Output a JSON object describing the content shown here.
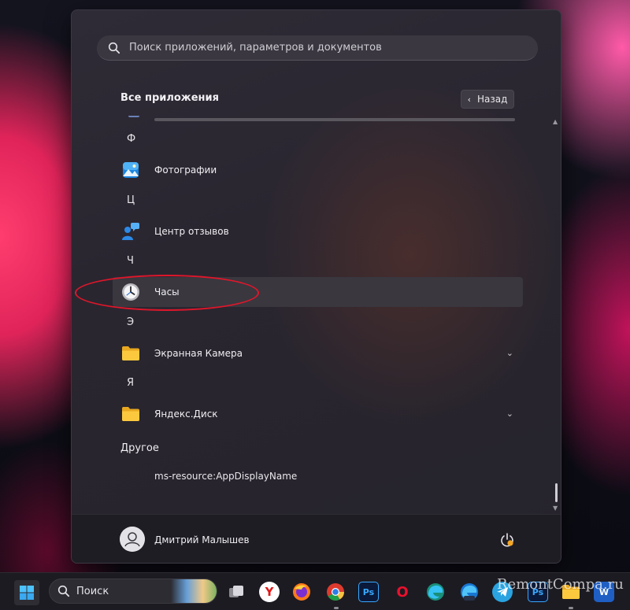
{
  "search": {
    "placeholder": "Поиск приложений, параметров и документов",
    "icon": "search-icon"
  },
  "all_apps": {
    "title": "Все приложения",
    "back_label": "Назад",
    "groups": [
      {
        "letter": "Ф",
        "apps": [
          {
            "label": "Фотографии",
            "icon": "photos-icon"
          }
        ]
      },
      {
        "letter": "Ц",
        "apps": [
          {
            "label": "Центр отзывов",
            "icon": "feedback-hub-icon"
          }
        ]
      },
      {
        "letter": "Ч",
        "apps": [
          {
            "label": "Часы",
            "icon": "clock-icon",
            "highlighted": true
          }
        ]
      },
      {
        "letter": "Э",
        "apps": [
          {
            "label": "Экранная Камера",
            "icon": "folder-icon",
            "expandable": true
          }
        ]
      },
      {
        "letter": "Я",
        "apps": [
          {
            "label": "Яндекс.Диск",
            "icon": "folder-icon",
            "expandable": true
          }
        ]
      }
    ],
    "other": {
      "title": "Другое",
      "items": [
        {
          "label": "ms-resource:AppDisplayName"
        }
      ]
    }
  },
  "footer": {
    "user_name": "Дмитрий Малышев",
    "avatar_icon": "user-avatar-icon",
    "power_icon": "power-icon"
  },
  "taskbar": {
    "search_label": "Поиск",
    "apps": [
      {
        "name": "task-view-icon"
      },
      {
        "name": "yandex-browser-icon",
        "glyph": "Y"
      },
      {
        "name": "firefox-icon"
      },
      {
        "name": "chrome-icon"
      },
      {
        "name": "photoshop-icon",
        "glyph": "Ps"
      },
      {
        "name": "opera-icon",
        "glyph": "O"
      },
      {
        "name": "edge-icon"
      },
      {
        "name": "edge-beta-icon"
      },
      {
        "name": "telegram-icon"
      },
      {
        "name": "photoshop-icon-2",
        "glyph": "Ps"
      },
      {
        "name": "file-explorer-icon"
      },
      {
        "name": "word-icon",
        "glyph": "W"
      }
    ]
  },
  "watermark": "RemontCompa.ru",
  "colors": {
    "annotation_ellipse": "#e0162a",
    "panel_bg": "#2a2630"
  }
}
